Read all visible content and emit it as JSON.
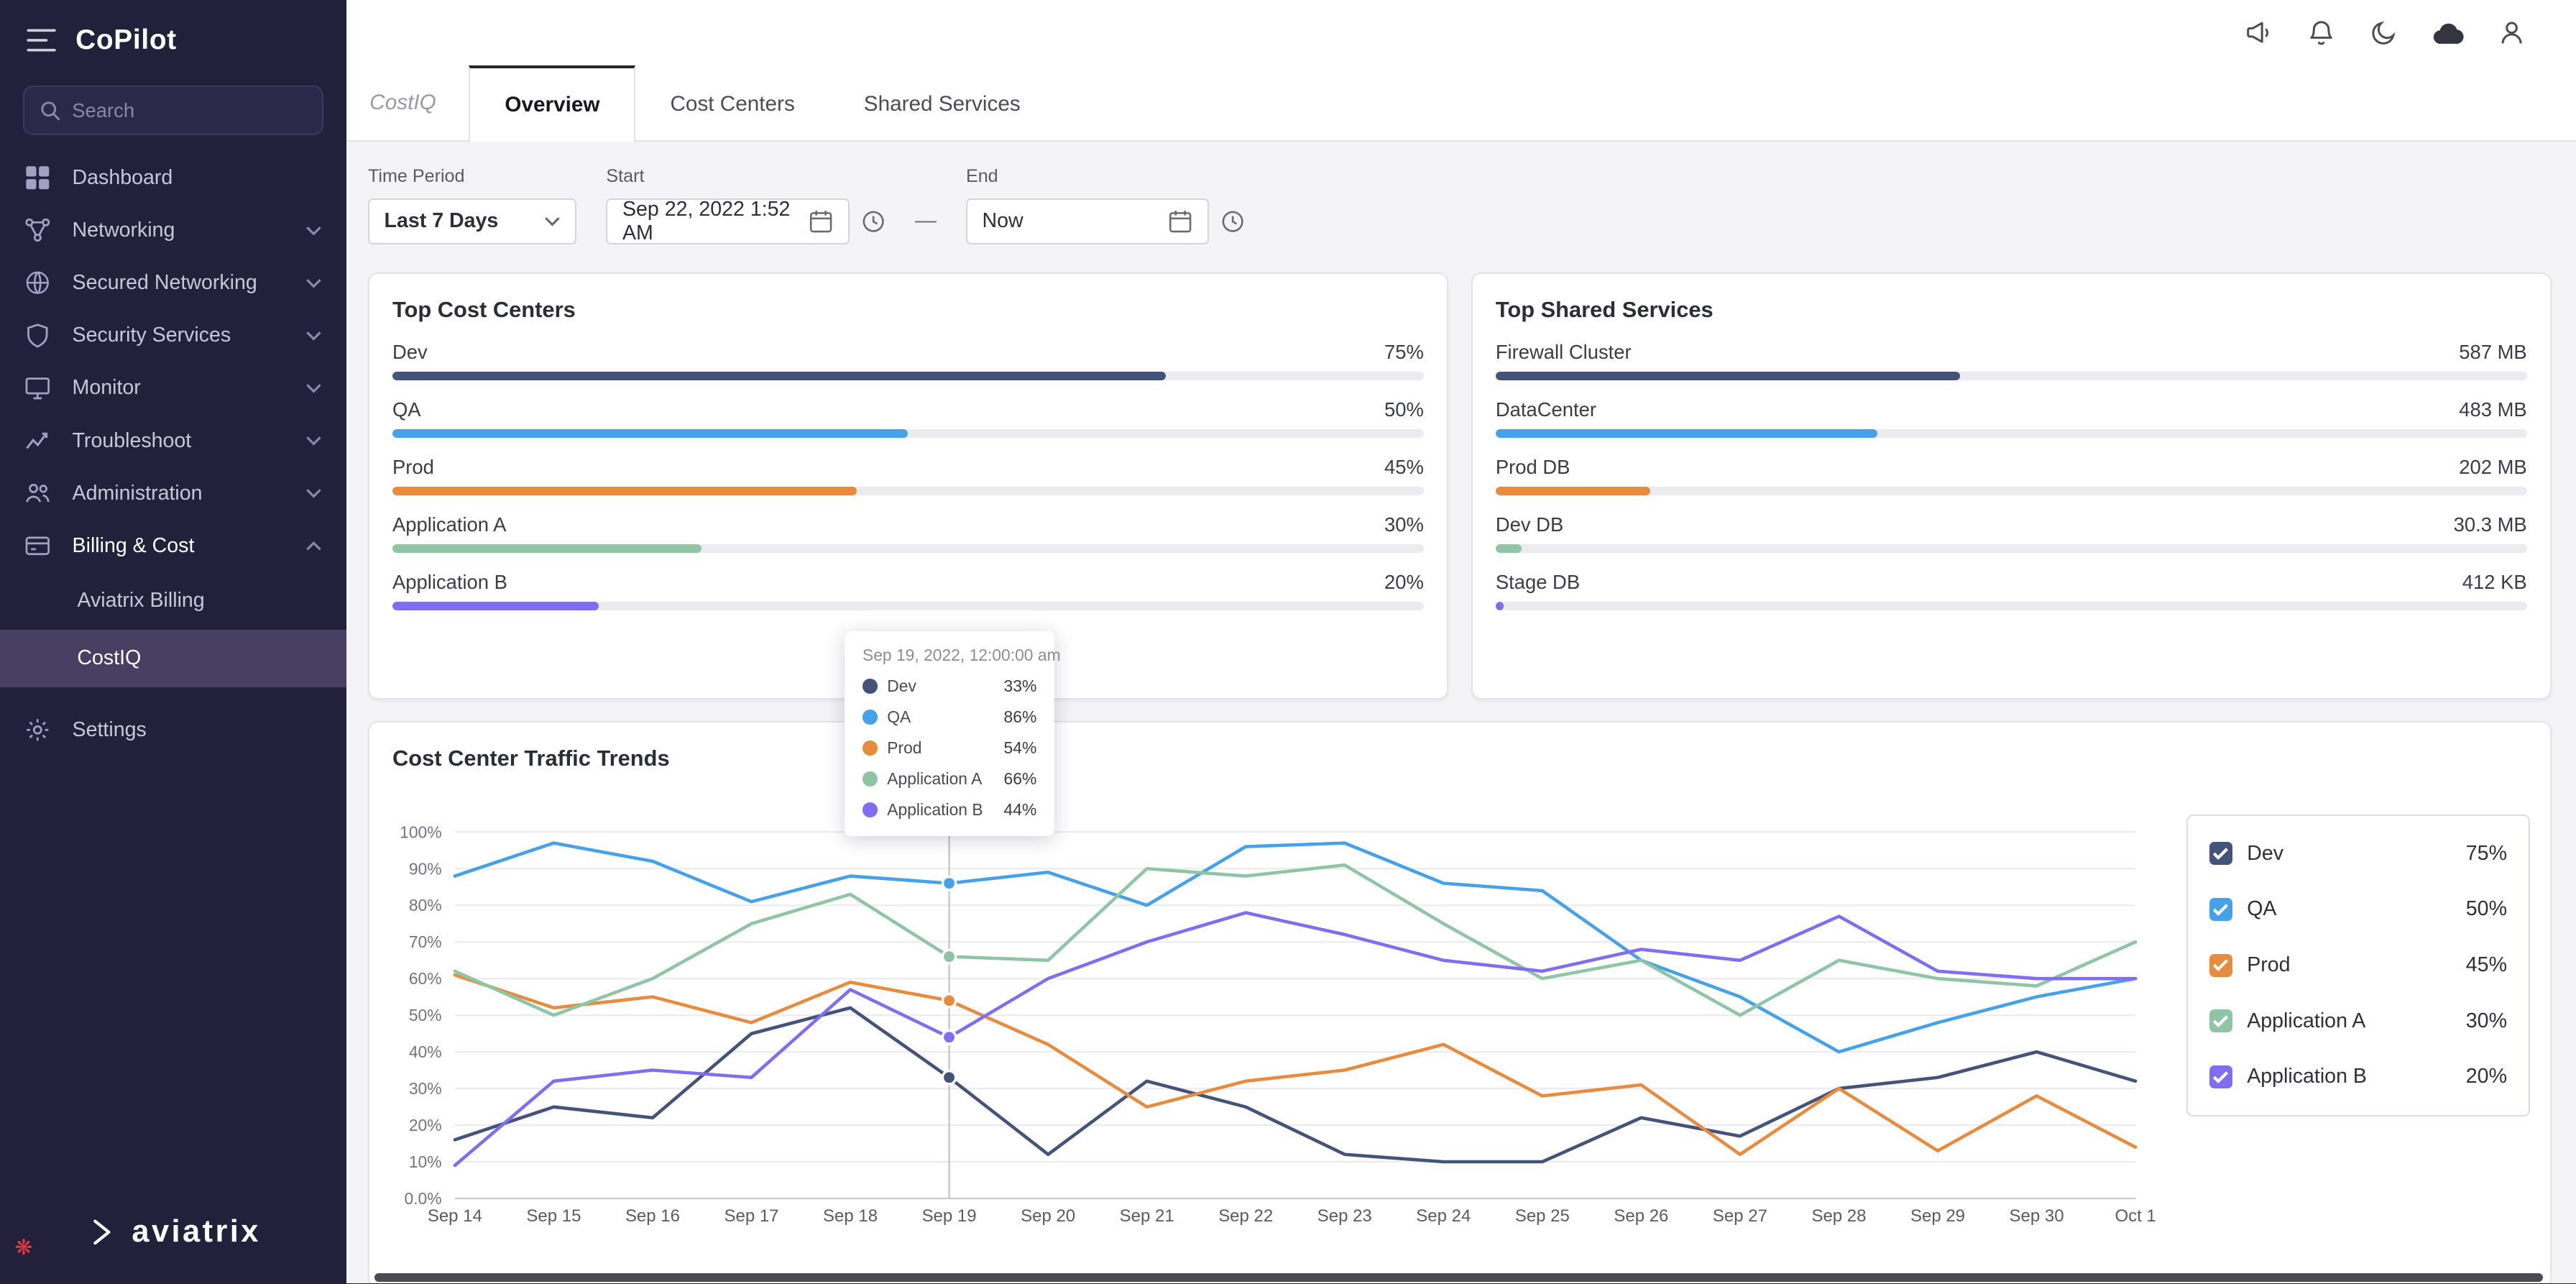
{
  "app": {
    "title": "CoPilot"
  },
  "sidebar": {
    "search_placeholder": "Search",
    "logo_text": "aviatrix",
    "items": [
      {
        "label": "Dashboard",
        "icon": "dashboard-icon"
      },
      {
        "label": "Networking",
        "icon": "networking-icon",
        "chevron": "down"
      },
      {
        "label": "Secured Networking",
        "icon": "secured-networking-icon",
        "chevron": "down"
      },
      {
        "label": "Security Services",
        "icon": "security-services-icon",
        "chevron": "down"
      },
      {
        "label": "Monitor",
        "icon": "monitor-icon",
        "chevron": "down"
      },
      {
        "label": "Troubleshoot",
        "icon": "troubleshoot-icon",
        "chevron": "down"
      },
      {
        "label": "Administration",
        "icon": "administration-icon",
        "chevron": "down"
      },
      {
        "label": "Billing & Cost",
        "icon": "billing-icon",
        "chevron": "up",
        "expanded": true,
        "children": [
          {
            "label": "Aviatrix Billing",
            "selected": false
          },
          {
            "label": "CostIQ",
            "selected": true
          }
        ]
      },
      {
        "label": "Settings",
        "icon": "settings-icon",
        "group_break": true
      }
    ]
  },
  "topbar": {
    "icons": [
      "announcement-icon",
      "notifications-bell-icon",
      "dark-mode-moon-icon",
      "cloud-icon",
      "user-profile-icon"
    ]
  },
  "tabs": {
    "module_label": "CostIQ",
    "items": [
      {
        "label": "Overview",
        "active": true
      },
      {
        "label": "Cost Centers",
        "active": false
      },
      {
        "label": "Shared Services",
        "active": false
      }
    ]
  },
  "filters": {
    "time_period": {
      "label": "Time Period",
      "value": "Last 7 Days"
    },
    "start": {
      "label": "Start",
      "value": "Sep 22, 2022 1:52 AM"
    },
    "separator": "—",
    "end": {
      "label": "End",
      "value": "Now"
    }
  },
  "top_cost_centers": {
    "title": "Top Cost Centers",
    "rows": [
      {
        "label": "Dev",
        "value": "75%",
        "bar_percent": 75,
        "color": "#43537a"
      },
      {
        "label": "QA",
        "value": "50%",
        "bar_percent": 50,
        "color": "#45a1e8"
      },
      {
        "label": "Prod",
        "value": "45%",
        "bar_percent": 45,
        "color": "#e78b3f"
      },
      {
        "label": "Application A",
        "value": "30%",
        "bar_percent": 30,
        "color": "#8ec6a5"
      },
      {
        "label": "Application B",
        "value": "20%",
        "bar_percent": 20,
        "color": "#7f6ef2"
      }
    ]
  },
  "top_shared_services": {
    "title": "Top Shared Services",
    "rows": [
      {
        "label": "Firewall Cluster",
        "value": "587 MB",
        "bar_percent": 45,
        "color": "#43537a"
      },
      {
        "label": "DataCenter",
        "value": "483 MB",
        "bar_percent": 37,
        "color": "#45a1e8"
      },
      {
        "label": "Prod DB",
        "value": "202 MB",
        "bar_percent": 15,
        "color": "#e78b3f"
      },
      {
        "label": "Dev DB",
        "value": "30.3 MB",
        "bar_percent": 2.5,
        "color": "#8ec6a5"
      },
      {
        "label": "Stage DB",
        "value": "412 KB",
        "bar_percent": 0.8,
        "color": "#7f6ef2"
      }
    ]
  },
  "tooltip": {
    "title": "Sep 19, 2022, 12:00:00 am",
    "rows": [
      {
        "label": "Dev",
        "value": "33%",
        "color": "#43537a"
      },
      {
        "label": "QA",
        "value": "86%",
        "color": "#45a1e8"
      },
      {
        "label": "Prod",
        "value": "54%",
        "color": "#e78b3f"
      },
      {
        "label": "Application A",
        "value": "66%",
        "color": "#8ec6a5"
      },
      {
        "label": "Application B",
        "value": "44%",
        "color": "#7f6ef2"
      }
    ]
  },
  "chart_card": {
    "title": "Cost Center Traffic Trends"
  },
  "chart_data": {
    "type": "line",
    "title": "Cost Center Traffic Trends",
    "x": [
      "Sep 14",
      "Sep 15",
      "Sep 16",
      "Sep 17",
      "Sep 18",
      "Sep 19",
      "Sep 20",
      "Sep 21",
      "Sep 22",
      "Sep 23",
      "Sep 24",
      "Sep 25",
      "Sep 26",
      "Sep 27",
      "Sep 28",
      "Sep 29",
      "Sep 30",
      "Oct 1"
    ],
    "ylim": [
      0,
      100
    ],
    "ytick_labels": [
      "0.0%",
      "10%",
      "20%",
      "30%",
      "40%",
      "50%",
      "60%",
      "70%",
      "80%",
      "90%",
      "100%"
    ],
    "grid": true,
    "legend_position": "right",
    "crosshair_x": "Sep 19",
    "series": [
      {
        "name": "Dev",
        "color": "#43537a",
        "values": [
          16,
          25,
          22,
          45,
          52,
          33,
          12,
          32,
          25,
          12,
          10,
          10,
          22,
          17,
          30,
          33,
          40,
          32
        ]
      },
      {
        "name": "QA",
        "color": "#45a1e8",
        "values": [
          88,
          97,
          92,
          81,
          88,
          86,
          89,
          80,
          96,
          97,
          86,
          84,
          65,
          55,
          40,
          48,
          55,
          60
        ]
      },
      {
        "name": "Prod",
        "color": "#e78b3f",
        "values": [
          61,
          52,
          55,
          48,
          59,
          54,
          42,
          25,
          32,
          35,
          42,
          28,
          31,
          12,
          30,
          13,
          28,
          14
        ]
      },
      {
        "name": "Application A",
        "color": "#8ec6a5",
        "values": [
          62,
          50,
          60,
          75,
          83,
          66,
          65,
          90,
          88,
          91,
          75,
          60,
          65,
          50,
          65,
          60,
          58,
          70
        ]
      },
      {
        "name": "Application B",
        "color": "#7f6ef2",
        "values": [
          9,
          32,
          35,
          33,
          57,
          44,
          60,
          70,
          78,
          72,
          65,
          62,
          68,
          65,
          77,
          62,
          60,
          60
        ]
      }
    ]
  },
  "legend": {
    "items": [
      {
        "label": "Dev",
        "value": "75%",
        "checked": true,
        "color": "#43537a"
      },
      {
        "label": "QA",
        "value": "50%",
        "checked": true,
        "color": "#45a1e8"
      },
      {
        "label": "Prod",
        "value": "45%",
        "checked": true,
        "color": "#e78b3f"
      },
      {
        "label": "Application A",
        "value": "30%",
        "checked": true,
        "color": "#8ec6a5"
      },
      {
        "label": "Application B",
        "value": "20%",
        "checked": true,
        "color": "#7f6ef2"
      }
    ]
  }
}
